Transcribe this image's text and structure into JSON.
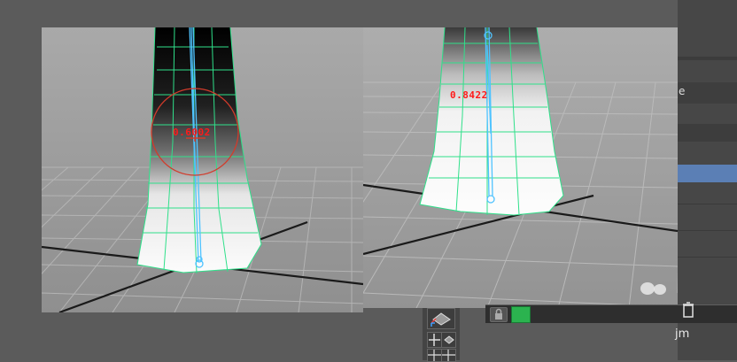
{
  "viewport_left": {
    "weight_value": "0.6002"
  },
  "viewport_right": {
    "weight_value": "0.8422"
  },
  "colors": {
    "mesh_wire": "#2fe08a",
    "joint": "#4fc3ff",
    "brush": "#d23b2b",
    "weight_text": "#ff1a1a",
    "selected_row": "#5b7fb5",
    "color_swatch": "#2bb34f"
  },
  "toolbar": {
    "partial_text": "jm",
    "tool_icons": [
      "paint-weights-icon",
      "grid-select-icon",
      "grid-icon"
    ]
  },
  "attribute_panel": {
    "truncated_label": "e"
  }
}
